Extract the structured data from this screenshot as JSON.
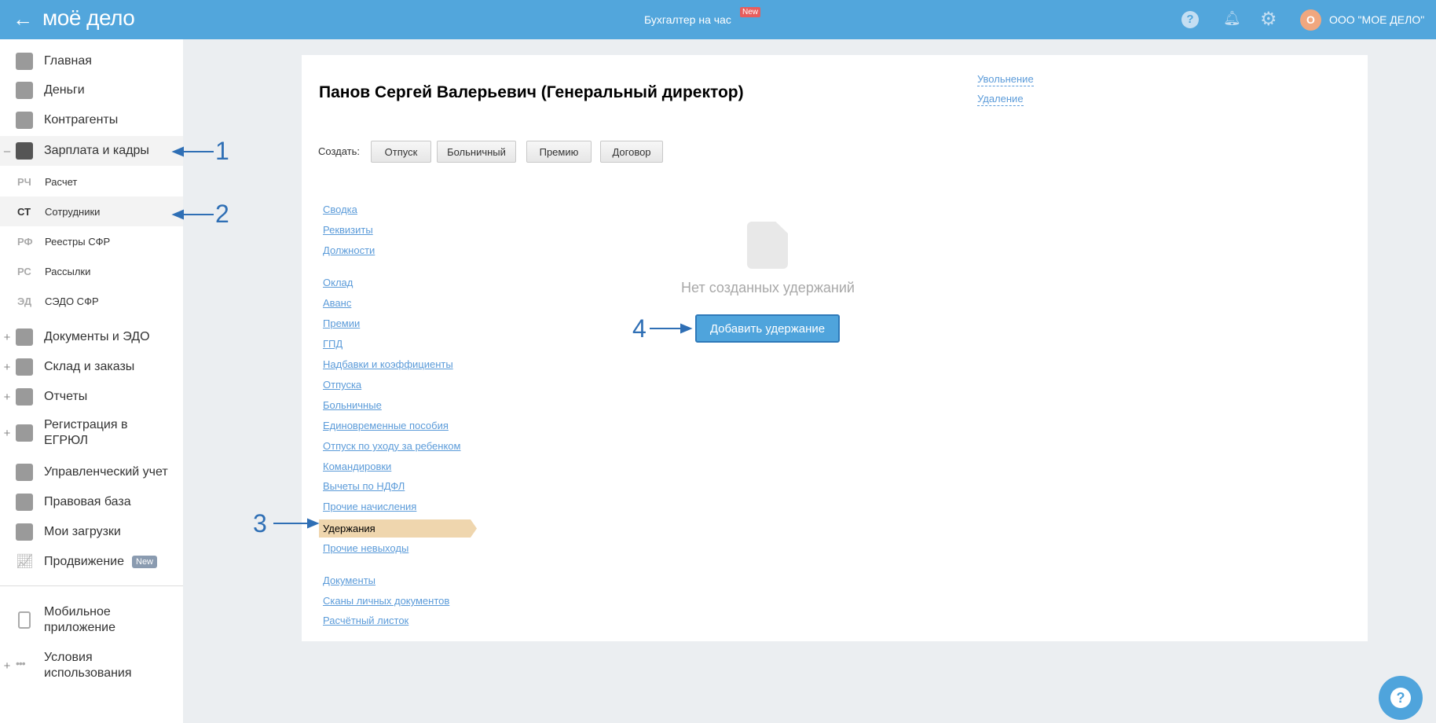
{
  "header": {
    "logo": "моё дело",
    "center_link": "Бухгалтер на час",
    "new_badge": "New",
    "avatar_letter": "О",
    "company": "ООО \"МОЕ ДЕЛО\""
  },
  "sidebar": {
    "items": [
      {
        "label": "Главная",
        "icon": "home-icon",
        "prefix": ""
      },
      {
        "label": "Деньги",
        "icon": "money-icon",
        "prefix": ""
      },
      {
        "label": "Контрагенты",
        "icon": "contractor-icon",
        "prefix": ""
      },
      {
        "label": "Зарплата и кадры",
        "icon": "wallet-icon",
        "prefix": "–"
      }
    ],
    "subitems": [
      {
        "abbr": "РЧ",
        "label": "Расчет"
      },
      {
        "abbr": "СТ",
        "label": "Сотрудники"
      },
      {
        "abbr": "РФ",
        "label": "Реестры СФР"
      },
      {
        "abbr": "РС",
        "label": "Рассылки"
      },
      {
        "abbr": "ЭД",
        "label": "СЭДО СФР"
      }
    ],
    "items2": [
      {
        "label": "Документы и ЭДО",
        "prefix": "+"
      },
      {
        "label": "Склад и заказы",
        "prefix": "+"
      },
      {
        "label": "Отчеты",
        "prefix": "+"
      },
      {
        "label": "Регистрация в ЕГРЮЛ",
        "prefix": "+"
      },
      {
        "label": "Управленческий учет",
        "prefix": ""
      },
      {
        "label": "Правовая база",
        "prefix": ""
      },
      {
        "label": "Мои загрузки",
        "prefix": ""
      },
      {
        "label": "Продвижение",
        "prefix": ""
      }
    ],
    "promo_badge": "New",
    "bottom": [
      {
        "label": "Мобильное приложение",
        "prefix": ""
      },
      {
        "label": "Условия использования",
        "prefix": "+"
      }
    ]
  },
  "employee": {
    "title": "Панов Сергей Валерьевич (Генеральный директор)",
    "actions": [
      "Увольнение",
      "Удаление"
    ],
    "create_label": "Создать:",
    "create_buttons": [
      "Отпуск",
      "Больничный",
      "Премию",
      "Договор"
    ],
    "nav_group1": [
      "Сводка",
      "Реквизиты",
      "Должности"
    ],
    "nav_group2": [
      "Оклад",
      "Аванс",
      "Премии",
      "ГПД",
      "Надбавки и коэффициенты",
      "Отпуска",
      "Больничные",
      "Единовременные пособия",
      "Отпуск по уходу за ребенком",
      "Командировки",
      "Вычеты по НДФЛ",
      "Прочие начисления",
      "Удержания",
      "Прочие невыходы"
    ],
    "nav_group3": [
      "Документы",
      "Сканы личных документов",
      "Расчётный листок"
    ],
    "empty_text": "Нет созданных удержаний",
    "add_button": "Добавить удержание"
  },
  "annotations": [
    "1",
    "2",
    "3",
    "4"
  ],
  "colors": {
    "header": "#52a6dc",
    "active_nav": "#efd6ae",
    "primary": "#4aa3df",
    "link": "#5b9bd9"
  }
}
